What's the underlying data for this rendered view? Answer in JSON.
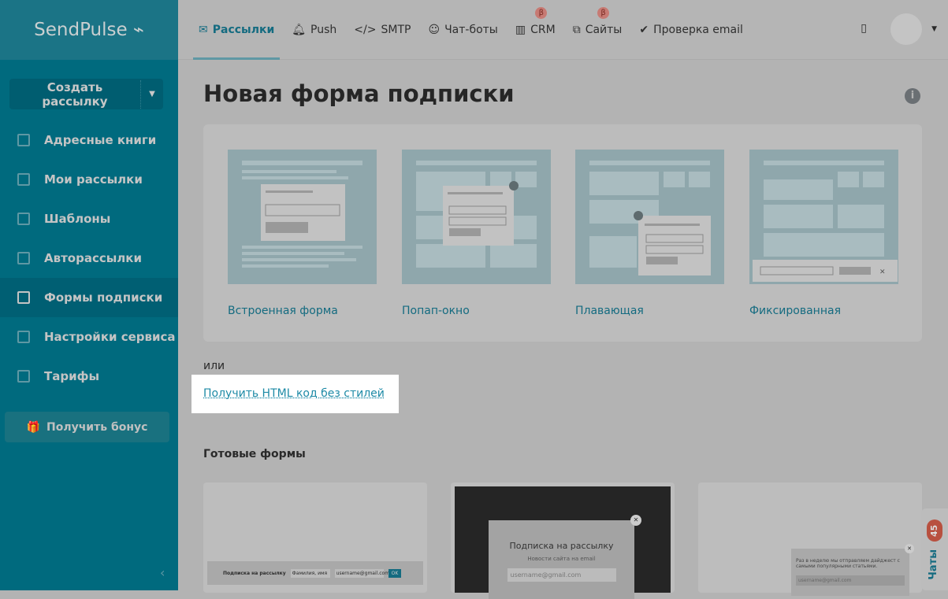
{
  "logo": "SendPulse",
  "sidebar": {
    "create": "Создать рассылку",
    "items": [
      {
        "label": "Адресные книги"
      },
      {
        "label": "Мои рассылки"
      },
      {
        "label": "Шаблоны"
      },
      {
        "label": "Авторассылки"
      },
      {
        "label": "Формы подписки",
        "active": true
      },
      {
        "label": "Настройки сервиса"
      },
      {
        "label": "Тарифы"
      }
    ],
    "bonus": "Получить бонус"
  },
  "topnav": {
    "tabs": [
      {
        "label": "Рассылки",
        "icon": "mail-icon"
      },
      {
        "label": "Push",
        "icon": "bell-icon"
      },
      {
        "label": "SMTP",
        "icon": "code-icon"
      },
      {
        "label": "Чат-боты",
        "icon": "chatbot-icon"
      },
      {
        "label": "CRM",
        "icon": "crm-icon",
        "beta": "β"
      },
      {
        "label": "Сайты",
        "icon": "sites-icon",
        "beta": "β"
      },
      {
        "label": "Проверка email",
        "icon": "check-icon"
      }
    ]
  },
  "main": {
    "title": "Новая форма подписки",
    "types": [
      {
        "label": "Встроенная форма"
      },
      {
        "label": "Попап-окно"
      },
      {
        "label": "Плавающая"
      },
      {
        "label": "Фиксированная"
      }
    ],
    "or": "или",
    "html_link": "Получить HTML код без стилей",
    "ready": "Готовые формы",
    "cards": [
      {
        "title": "Подписка на рассылку",
        "name_ph": "Фамилия, имя",
        "email_ph": "username@gmail.com",
        "ok": "OK"
      },
      {
        "title": "Подписка на рассылку",
        "subtitle": "Новости сайта на email",
        "email_ph": "username@gmail.com"
      },
      {
        "text": "Раз в неделю мы отправляем дайджест с самыми популярными статьями.",
        "email_ph": "username@gmail.com"
      }
    ]
  },
  "chat": {
    "label": "Чаты",
    "count": "45"
  }
}
